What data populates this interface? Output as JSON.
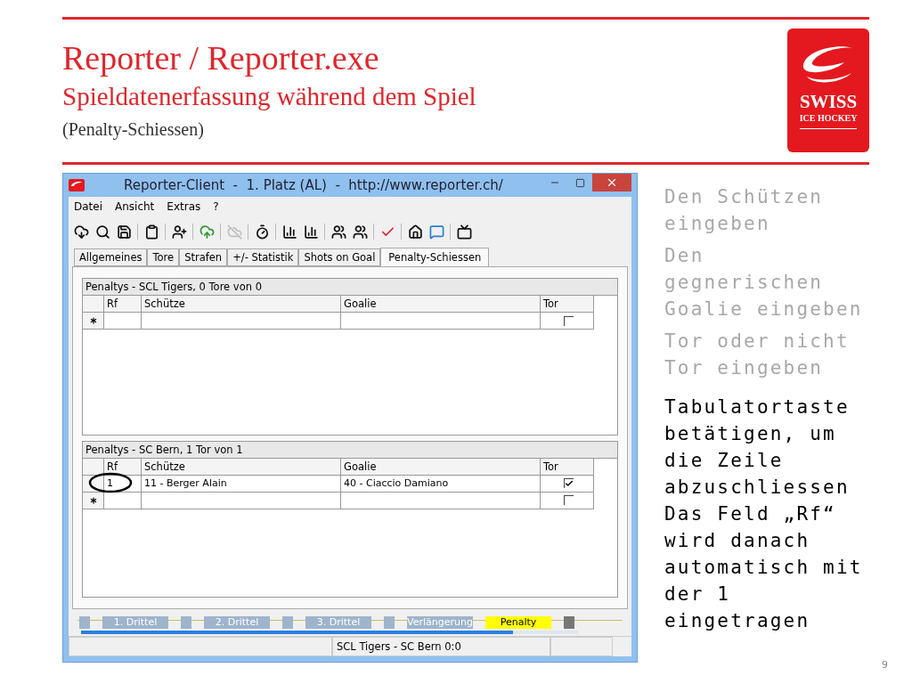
{
  "slide": {
    "title": "Reporter / Reporter.exe",
    "subtitle": "Spieldatenerfassung während dem Spiel",
    "note": "(Penalty-Schiessen)",
    "page": "9"
  },
  "logo": {
    "line1": "SWISS",
    "line2": "ICE HOCKEY"
  },
  "window": {
    "title": "Reporter-Client  -  1. Platz (AL)  -  http://www.reporter.ch/",
    "menu": [
      "Datei",
      "Ansicht",
      "Extras",
      "?"
    ],
    "toolbar_groups": [
      [
        {
          "disabled": false
        },
        {
          "disabled": false
        },
        {
          "disabled": false
        }
      ],
      [
        {
          "disabled": false
        }
      ],
      [
        {
          "disabled": false
        }
      ],
      [
        {
          "disabled": false
        }
      ],
      [
        {
          "disabled": true
        }
      ],
      [
        {
          "disabled": false
        }
      ],
      [
        {
          "disabled": false
        },
        {
          "disabled": false
        }
      ],
      [
        {
          "disabled": false
        },
        {
          "disabled": false
        }
      ],
      [
        {
          "disabled": false
        }
      ],
      [
        {
          "disabled": false
        },
        {
          "disabled": false
        }
      ],
      [
        {
          "disabled": false
        }
      ]
    ],
    "tabs": [
      {
        "label": "Allgemeines",
        "selected": false
      },
      {
        "label": "Tore",
        "selected": false
      },
      {
        "label": "Strafen",
        "selected": false
      },
      {
        "label": "+/- Statistik",
        "selected": false
      },
      {
        "label": "Shots on Goal",
        "selected": false
      },
      {
        "label": "Penalty-Schiessen",
        "selected": true
      }
    ],
    "groups": [
      {
        "title": "Penaltys - SCL Tigers, 0 Tore von 0",
        "columns": [
          "Rf",
          "Schütze",
          "Goalie",
          "Tor"
        ],
        "rows": [
          {
            "kind": "new",
            "rf": "",
            "shooter": "",
            "goalie": "",
            "goal": false,
            "rf_circled": false
          }
        ]
      },
      {
        "title": "Penaltys - SC Bern, 1 Tor von 1",
        "columns": [
          "Rf",
          "Schütze",
          "Goalie",
          "Tor"
        ],
        "rows": [
          {
            "kind": "data",
            "rf": "1",
            "shooter": "11 - Berger Alain",
            "goalie": "40 - Ciaccio Damiano",
            "goal": true,
            "rf_circled": true
          },
          {
            "kind": "new",
            "rf": "",
            "shooter": "",
            "goalie": "",
            "goal": false,
            "rf_circled": false
          }
        ]
      }
    ],
    "periods": [
      {
        "label": "1. Drittel",
        "selected": false
      },
      {
        "label": "2. Drittel",
        "selected": false
      },
      {
        "label": "3. Drittel",
        "selected": false
      },
      {
        "label": "Verlängerung",
        "selected": false
      },
      {
        "label": "Penalty",
        "selected": true
      }
    ],
    "progress": {
      "level": 0.87
    },
    "status_bar": {
      "text": "SCL Tigers - SC Bern 0:0"
    }
  },
  "notes": [
    {
      "text": "Den Schützen eingeben",
      "dimmed": true
    },
    {
      "text": "Den gegnerischen Goalie eingeben",
      "dimmed": true
    },
    {
      "text": "Tor oder nicht Tor eingeben",
      "dimmed": true
    },
    {
      "text": "Tabulatortaste betätigen, um die Zeile abzuschliessen Das Feld „Rf“ wird danach automatisch mit der 1 eingetragen",
      "dimmed": false
    }
  ]
}
